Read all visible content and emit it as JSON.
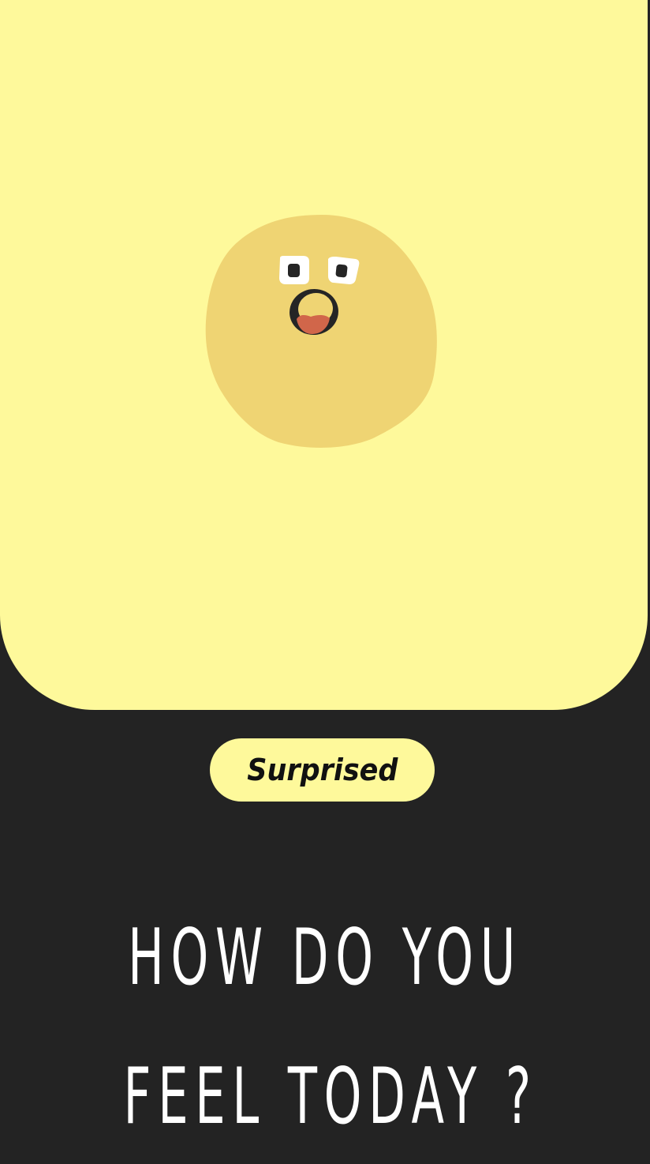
{
  "mood": {
    "label": "Surprised",
    "face_icon": "surprised-face-icon",
    "card_color": "#FEF99B",
    "face_color": "#EFD473",
    "mouth_color": "#D1664A"
  },
  "prompt": {
    "line1": "HOW DO YOU",
    "line2": "FEEL TODAY ?"
  },
  "theme": {
    "background": "#232323",
    "text": "#FFFFFF"
  }
}
